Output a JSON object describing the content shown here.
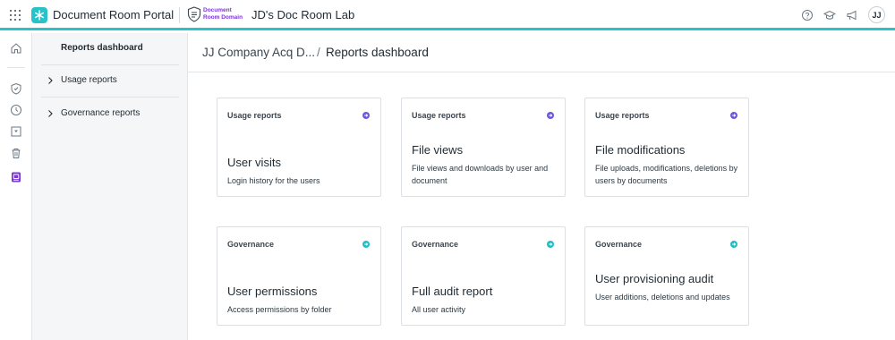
{
  "app": {
    "name": "Document Room Portal",
    "domain_line1": "Document",
    "domain_line2": "Room Domain",
    "workspace": "JD's Doc Room Lab",
    "user_initials": "JJ",
    "accent": "#27c3c9",
    "domain_color": "#7a3ad0"
  },
  "topbar_icons": [
    "help-icon",
    "graduation-cap-icon",
    "megaphone-icon"
  ],
  "rail_icons": [
    "home-icon",
    "shield-icon",
    "clock-icon",
    "inbox-download-icon",
    "trash-icon",
    "report-icon"
  ],
  "subnav": {
    "title": "Reports dashboard",
    "items": [
      {
        "label": "Usage reports"
      },
      {
        "label": "Governance reports"
      }
    ]
  },
  "breadcrumb": {
    "parent": "JJ Company Acq D...",
    "separator": "/",
    "current": "Reports dashboard"
  },
  "cards": [
    {
      "category": "Usage reports",
      "title": "User visits",
      "description": "Login history for the users",
      "accent": "#6b5bd6"
    },
    {
      "category": "Usage reports",
      "title": "File views",
      "description": "File views and downloads by user and document",
      "accent": "#6b5bd6"
    },
    {
      "category": "Usage reports",
      "title": "File modifications",
      "description": "File uploads, modifications, deletions by users by documents",
      "accent": "#6b5bd6"
    },
    {
      "category": "Governance",
      "title": "User permissions",
      "description": "Access permissions by folder",
      "accent": "#22bdc4"
    },
    {
      "category": "Governance",
      "title": "Full audit report",
      "description": "All user activity",
      "accent": "#22bdc4"
    },
    {
      "category": "Governance",
      "title": "User provisioning audit",
      "description": "User additions, deletions and updates",
      "accent": "#22bdc4"
    }
  ]
}
